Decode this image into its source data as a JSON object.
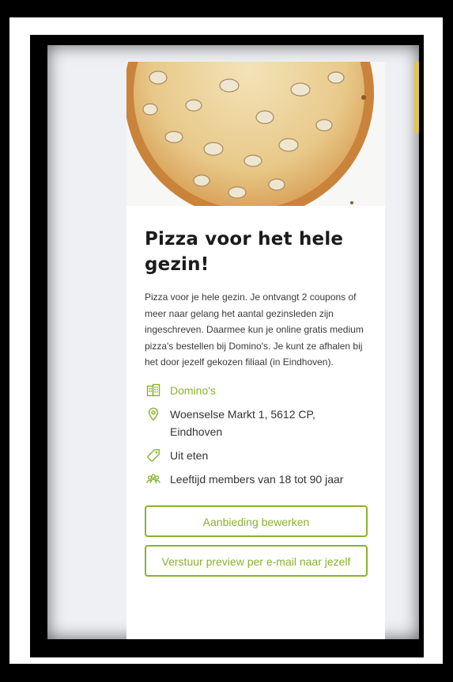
{
  "offer": {
    "title": "Pizza voor het hele gezin!",
    "description": "Pizza voor je hele gezin. Je ontvangt 2 coupons of meer naar gelang het aantal gezinsleden zijn ingeschreven. Daarmee kun je online gratis medium pizza's bestellen bij Domino's. Je kunt ze afhalen bij het door jezelf gekozen filiaal (in Eindhoven).",
    "partner": "Domino's",
    "address": "Woenselse Markt 1, 5612 CP, Eindhoven",
    "category": "Uit eten",
    "age_range": "Leeftijd members van 18 tot 90 jaar"
  },
  "buttons": {
    "edit": "Aanbieding bewerken",
    "preview": "Verstuur preview per e-mail naar jezelf"
  },
  "icons": {
    "partner": "building-icon",
    "address": "location-pin-icon",
    "category": "tag-icon",
    "age": "people-icon",
    "image": "pizza-image"
  },
  "colors": {
    "accent": "#8ab22e",
    "scroll_indicator": "#e0c64a",
    "title": "#1b1b1b"
  }
}
